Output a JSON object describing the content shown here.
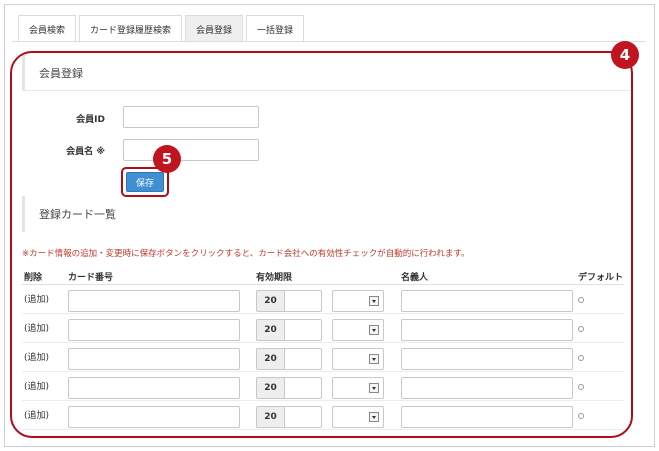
{
  "tabs": [
    {
      "label": "会員検索",
      "active": false
    },
    {
      "label": "カード登録履歴検索",
      "active": false
    },
    {
      "label": "会員登録",
      "active": true
    },
    {
      "label": "一括登録",
      "active": false
    }
  ],
  "callouts": {
    "badge_4": "4",
    "badge_5": "5",
    "color": "#b00c1c"
  },
  "member_section": {
    "title": "会員登録",
    "member_id_label": "会員ID",
    "member_id_value": "",
    "member_name_label": "会員名 ※",
    "member_name_value": "",
    "save_label": "保存",
    "save_color": "#3f8fd2"
  },
  "card_section": {
    "title": "登録カード一覧",
    "notice": "※カード情報の追加・変更時に保存ボタンをクリックすると、カード会社への有効性チェックが自動的に行われます。",
    "notice_color": "#c0392b",
    "headers": {
      "delete": "削除",
      "card_number": "カード番号",
      "expiry": "有効期限",
      "holder": "名義人",
      "default": "デフォルト"
    },
    "rows": [
      {
        "action": "(追加)",
        "year_prefix": "20"
      },
      {
        "action": "(追加)",
        "year_prefix": "20"
      },
      {
        "action": "(追加)",
        "year_prefix": "20"
      },
      {
        "action": "(追加)",
        "year_prefix": "20"
      },
      {
        "action": "(追加)",
        "year_prefix": "20"
      }
    ]
  }
}
